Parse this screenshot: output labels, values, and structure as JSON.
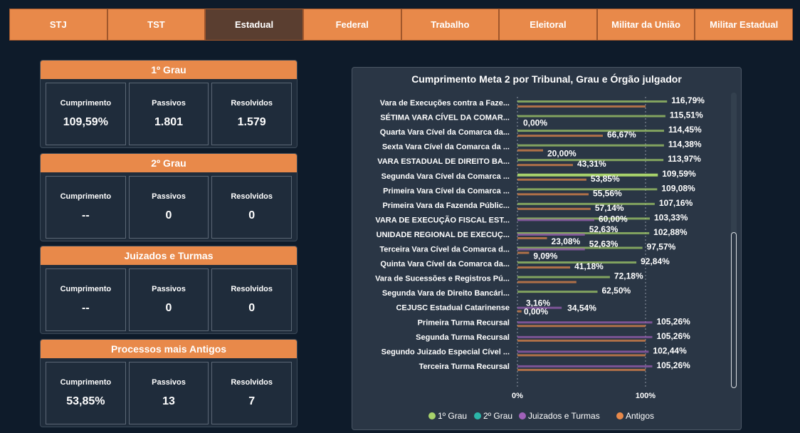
{
  "tabs": [
    {
      "label": "STJ",
      "active": false
    },
    {
      "label": "TST",
      "active": false
    },
    {
      "label": "Estadual",
      "active": true
    },
    {
      "label": "Federal",
      "active": false
    },
    {
      "label": "Trabalho",
      "active": false
    },
    {
      "label": "Eleitoral",
      "active": false
    },
    {
      "label": "Militar da União",
      "active": false
    },
    {
      "label": "Militar Estadual",
      "active": false
    }
  ],
  "cards": [
    {
      "title": "1º Grau",
      "kpis": [
        {
          "label": "Cumprimento",
          "value": "109,59%"
        },
        {
          "label": "Passivos",
          "value": "1.801"
        },
        {
          "label": "Resolvidos",
          "value": "1.579"
        }
      ]
    },
    {
      "title": "2º Grau",
      "kpis": [
        {
          "label": "Cumprimento",
          "value": "--"
        },
        {
          "label": "Passivos",
          "value": "0"
        },
        {
          "label": "Resolvidos",
          "value": "0"
        }
      ]
    },
    {
      "title": "Juizados e Turmas",
      "kpis": [
        {
          "label": "Cumprimento",
          "value": "--"
        },
        {
          "label": "Passivos",
          "value": "0"
        },
        {
          "label": "Resolvidos",
          "value": "0"
        }
      ]
    },
    {
      "title": "Processos mais Antigos",
      "kpis": [
        {
          "label": "Cumprimento",
          "value": "53,85%"
        },
        {
          "label": "Passivos",
          "value": "13"
        },
        {
          "label": "Resolvidos",
          "value": "7"
        }
      ]
    }
  ],
  "chart_data": {
    "type": "bar",
    "orientation": "horizontal",
    "title": "Cumprimento Meta 2 por Tribunal, Grau e Órgão julgador",
    "x_ticks": [
      "0%",
      "100%"
    ],
    "xlim": [
      0,
      130
    ],
    "grid": true,
    "legend_position": "bottom",
    "colors": {
      "1º Grau": "#a8d26b",
      "2º Grau": "#2bb5a8",
      "Juizados e Turmas": "#a061b9",
      "Antigos": "#e8894a"
    },
    "legend": [
      "1º Grau",
      "2º Grau",
      "Juizados e Turmas",
      "Antigos"
    ],
    "categories": [
      {
        "name": "Vara de Execuções contra a Faze...",
        "bars": [
          {
            "series": "1º Grau",
            "value": 116.79,
            "label": "116,79%"
          },
          {
            "series": "Antigos",
            "value": 100,
            "label": ""
          }
        ]
      },
      {
        "name": "SÉTIMA VARA CÍVEL DA COMAR...",
        "bars": [
          {
            "series": "1º Grau",
            "value": 115.51,
            "label": "115,51%"
          },
          {
            "series": "Antigos",
            "value": 0,
            "label": "0,00%"
          }
        ]
      },
      {
        "name": "Quarta Vara Cível da Comarca da...",
        "bars": [
          {
            "series": "1º Grau",
            "value": 114.45,
            "label": "114,45%"
          },
          {
            "series": "Antigos",
            "value": 66.67,
            "label": "66,67%"
          }
        ]
      },
      {
        "name": "Sexta Vara Cível da Comarca da ...",
        "bars": [
          {
            "series": "1º Grau",
            "value": 114.38,
            "label": "114,38%"
          },
          {
            "series": "Antigos",
            "value": 20.0,
            "label": "20,00%"
          }
        ]
      },
      {
        "name": "VARA ESTADUAL DE DIREITO BA...",
        "bars": [
          {
            "series": "1º Grau",
            "value": 113.97,
            "label": "113,97%"
          },
          {
            "series": "Antigos",
            "value": 43.31,
            "label": "43,31%"
          }
        ]
      },
      {
        "name": "Segunda Vara Cível da Comarca ...",
        "highlight": true,
        "bars": [
          {
            "series": "1º Grau",
            "value": 109.59,
            "label": "109,59%"
          },
          {
            "series": "Antigos",
            "value": 53.85,
            "label": "53,85%"
          }
        ]
      },
      {
        "name": "Primeira Vara Cível da Comarca ...",
        "bars": [
          {
            "series": "1º Grau",
            "value": 109.08,
            "label": "109,08%"
          },
          {
            "series": "Antigos",
            "value": 55.56,
            "label": "55,56%"
          }
        ]
      },
      {
        "name": "Primeira Vara da Fazenda Públic...",
        "bars": [
          {
            "series": "1º Grau",
            "value": 107.16,
            "label": "107,16%"
          },
          {
            "series": "Antigos",
            "value": 57.14,
            "label": "57,14%"
          }
        ]
      },
      {
        "name": "VARA DE EXECUÇÃO FISCAL EST...",
        "bars": [
          {
            "series": "1º Grau",
            "value": 103.33,
            "label": "103,33%"
          },
          {
            "series": "Juizados e Turmas",
            "value": 60.0,
            "label": "60,00%"
          }
        ]
      },
      {
        "name": "UNIDADE REGIONAL DE EXECUÇ...",
        "bars": [
          {
            "series": "1º Grau",
            "value": 102.88,
            "label": "102,88%"
          },
          {
            "series": "Juizados e Turmas",
            "value": 52.63,
            "label": "52,63%"
          },
          {
            "series": "Antigos",
            "value": 23.08,
            "label": "23,08%"
          }
        ]
      },
      {
        "name": "Terceira Vara Cível da Comarca d...",
        "bars": [
          {
            "series": "1º Grau",
            "value": 97.57,
            "label": "97,57%"
          },
          {
            "series": "Juizados e Turmas",
            "value": 52.63,
            "label": "52,63%"
          },
          {
            "series": "Antigos",
            "value": 9.09,
            "label": "9,09%"
          }
        ]
      },
      {
        "name": "Quinta Vara Cível da Comarca da...",
        "bars": [
          {
            "series": "1º Grau",
            "value": 92.84,
            "label": "92,84%"
          },
          {
            "series": "Antigos",
            "value": 41.18,
            "label": "41,18%"
          }
        ]
      },
      {
        "name": "Vara de Sucessões e Registros Pú...",
        "bars": [
          {
            "series": "1º Grau",
            "value": 72.18,
            "label": "72,18%"
          },
          {
            "series": "Antigos",
            "value": 46.0,
            "label": ""
          }
        ]
      },
      {
        "name": "Segunda Vara de Direito Bancári...",
        "bars": [
          {
            "series": "1º Grau",
            "value": 62.5,
            "label": "62,50%"
          }
        ]
      },
      {
        "name": "CEJUSC Estadual Catarinense",
        "bars": [
          {
            "series": "Antigos",
            "value": 3.16,
            "label": "3,16%"
          },
          {
            "series": "Juizados e Turmas",
            "value": 34.54,
            "label": "34,54%"
          },
          {
            "series": "2º Grau",
            "value": 0,
            "label": "0,00%"
          }
        ]
      },
      {
        "name": "Primeira Turma Recursal",
        "bars": [
          {
            "series": "Juizados e Turmas",
            "value": 105.26,
            "label": "105,26%"
          },
          {
            "series": "Antigos",
            "value": 100,
            "label": ""
          }
        ]
      },
      {
        "name": "Segunda Turma Recursal",
        "bars": [
          {
            "series": "Juizados e Turmas",
            "value": 105.26,
            "label": "105,26%"
          },
          {
            "series": "Antigos",
            "value": 100,
            "label": ""
          }
        ]
      },
      {
        "name": "Segundo Juizado Especial Cível ...",
        "bars": [
          {
            "series": "Juizados e Turmas",
            "value": 102.44,
            "label": "102,44%"
          },
          {
            "series": "Antigos",
            "value": 100,
            "label": ""
          }
        ]
      },
      {
        "name": "Terceira Turma Recursal",
        "bars": [
          {
            "series": "Juizados e Turmas",
            "value": 105.26,
            "label": "105,26%"
          },
          {
            "series": "Antigos",
            "value": 100,
            "label": ""
          }
        ]
      }
    ]
  }
}
